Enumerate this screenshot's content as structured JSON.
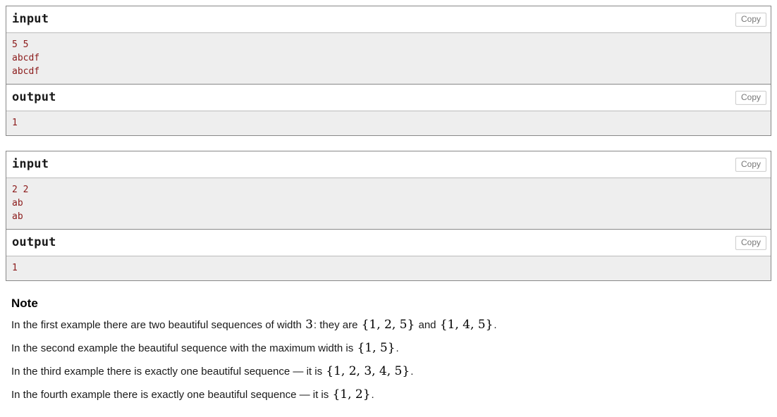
{
  "samples": [
    {
      "input_label": "input",
      "input_copy_label": "Copy",
      "input_text": "5 5\nabcdf\nabcdf",
      "output_label": "output",
      "output_copy_label": "Copy",
      "output_text": "1"
    },
    {
      "input_label": "input",
      "input_copy_label": "Copy",
      "input_text": "2 2\nab\nab",
      "output_label": "output",
      "output_copy_label": "Copy",
      "output_text": "1"
    }
  ],
  "note": {
    "heading": "Note",
    "paragraphs": [
      {
        "lead": "In the first example there are two beautiful sequences of width ",
        "math1": "3",
        "mid1": ": they are ",
        "math2": "{1, 2, 5}",
        "mid2": " and ",
        "math3": "{1, 4, 5}",
        "tail": "."
      },
      {
        "lead": "In the second example the beautiful sequence with the maximum width is ",
        "math1": "{1, 5}",
        "tail": "."
      },
      {
        "lead": "In the third example there is exactly one beautiful sequence — it is ",
        "math1": "{1, 2, 3, 4, 5}",
        "tail": "."
      },
      {
        "lead": "In the fourth example there is exactly one beautiful sequence — it is ",
        "math1": "{1, 2}",
        "tail": "."
      }
    ]
  },
  "colors": {
    "sample_text": "#8b1a1a",
    "sample_background": "#eeeeee",
    "border": "#888888",
    "copy_text": "#777777"
  }
}
